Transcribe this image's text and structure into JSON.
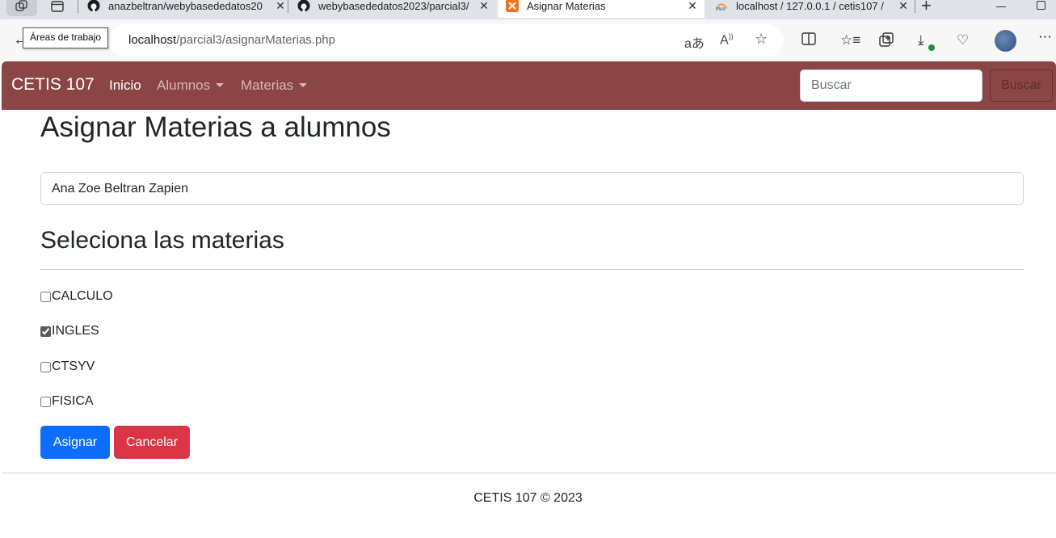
{
  "browser": {
    "tabs": [
      {
        "title": "anazbeltran/webybasededatos20",
        "icon": "github-icon"
      },
      {
        "title": "webybasededatos2023/parcial3/",
        "icon": "github-icon"
      },
      {
        "title": "Asignar Materias",
        "icon": "xampp-icon",
        "active": true
      },
      {
        "title": "localhost / 127.0.0.1 / cetis107 /",
        "icon": "phpmyadmin-icon"
      }
    ],
    "tooltip": "Áreas de trabajo",
    "url_host": "localhost",
    "url_path": "/parcial3/asignarMaterias.php"
  },
  "navbar": {
    "brand": "CETIS 107",
    "links": [
      "Inicio",
      "Alumnos",
      "Materias"
    ],
    "search_placeholder": "Buscar",
    "search_button": "Buscar",
    "color": "#8b4545"
  },
  "main": {
    "title": "Asignar Materias a alumnos",
    "student_name": "Ana Zoe Beltran Zapien",
    "subtitle": "Seleciona las materias",
    "subjects": [
      {
        "label": "CALCULO",
        "checked": false
      },
      {
        "label": "INGLES",
        "checked": true
      },
      {
        "label": "CTSYV",
        "checked": false
      },
      {
        "label": "FISICA",
        "checked": false
      }
    ],
    "assign_button": "Asignar",
    "cancel_button": "Cancelar",
    "primary_color": "#0d6efd",
    "danger_color": "#dc3545"
  },
  "footer": {
    "text": "CETIS 107 © 2023"
  }
}
